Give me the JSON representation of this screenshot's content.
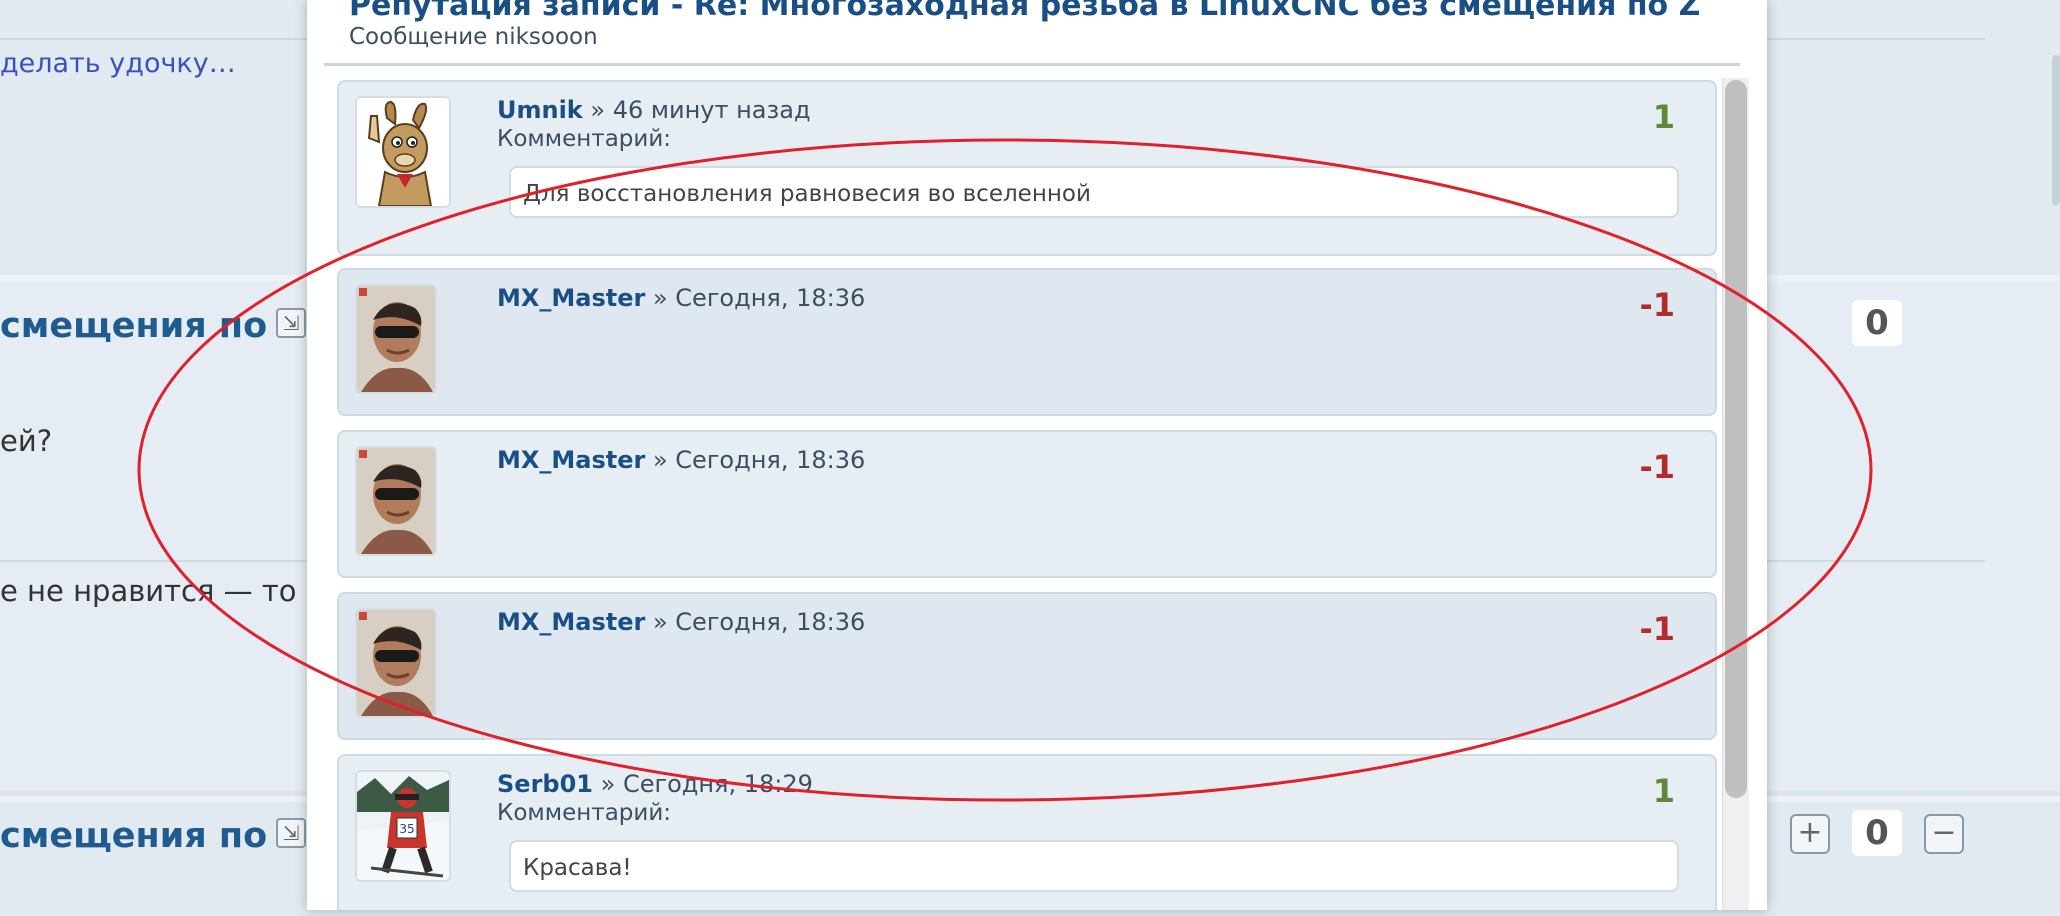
{
  "background": {
    "top_link": "делать удочку…",
    "thread_title_1": "смещения по Z",
    "thread_title_2": "смещения по Z",
    "post_text_1": "ей?",
    "post_text_2": "е не нравится — то и",
    "score_1": "0",
    "score_2": "0",
    "plus_label": "+",
    "minus_label": "−"
  },
  "modal": {
    "title": "Репутация записи - Re: Многозаходная резьба в LinuxCNC без смещения по Z",
    "subtitle": "Сообщение niksooon",
    "entries": [
      {
        "user": "Umnik",
        "time": "» 46 минут назад",
        "comment_label": "Комментарий:",
        "comment": "Для восстановления равновесия во вселенной",
        "points": "1",
        "avatar": "cartoon-rabbit-avatar"
      },
      {
        "user": "MX_Master",
        "time": "» Сегодня, 18:36",
        "points": "-1",
        "avatar": "man-sunglasses-avatar"
      },
      {
        "user": "MX_Master",
        "time": "» Сегодня, 18:36",
        "points": "-1",
        "avatar": "man-sunglasses-avatar"
      },
      {
        "user": "MX_Master",
        "time": "» Сегодня, 18:36",
        "points": "-1",
        "avatar": "man-sunglasses-avatar"
      },
      {
        "user": "Serb01",
        "time": "» Сегодня, 18:29",
        "comment_label": "Комментарий:",
        "comment": "Красава!",
        "points": "1",
        "avatar": "skier-avatar"
      }
    ]
  },
  "colors": {
    "positive": "#5d8a3a",
    "negative": "#b32b2b",
    "link": "#1a4f85",
    "annotation": "#e0202a"
  }
}
